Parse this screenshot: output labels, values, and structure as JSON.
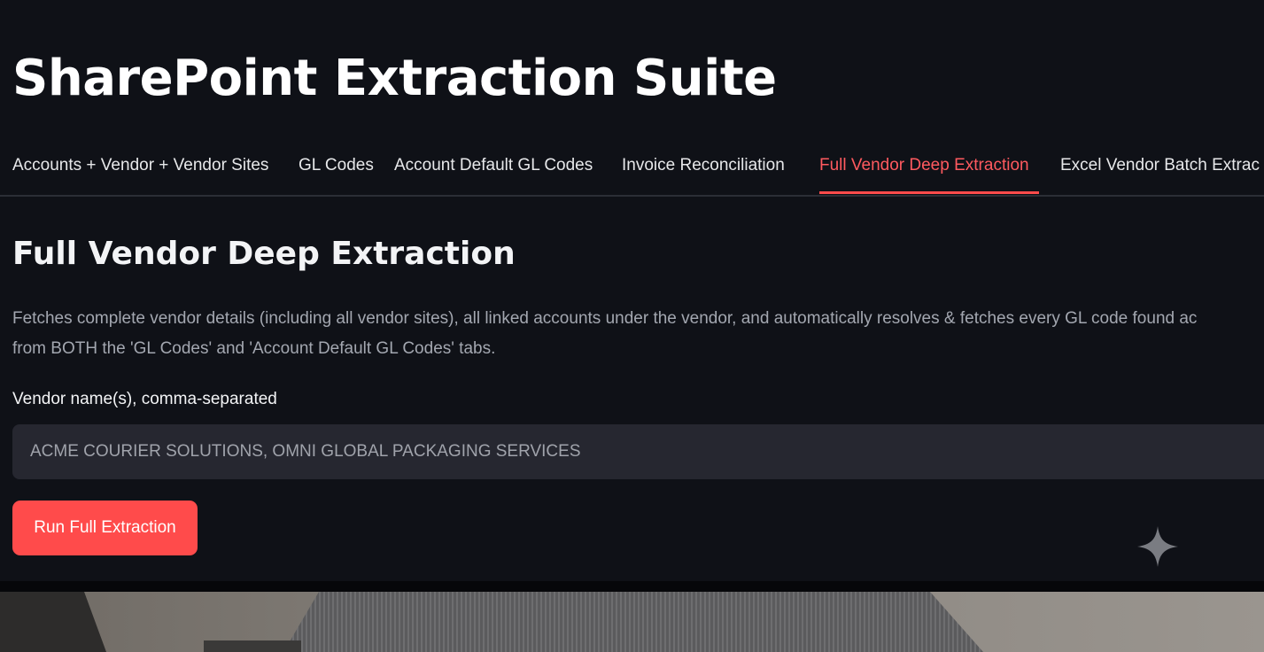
{
  "app": {
    "title": "SharePoint Extraction Suite"
  },
  "tabs": [
    {
      "label": "Accounts + Vendor + Vendor Sites",
      "active": false
    },
    {
      "label": "GL Codes",
      "active": false
    },
    {
      "label": "Account Default GL Codes",
      "active": false
    },
    {
      "label": "Invoice Reconciliation",
      "active": false
    },
    {
      "label": "Full Vendor Deep Extraction",
      "active": true
    },
    {
      "label": "Excel Vendor Batch Extrac",
      "active": false
    }
  ],
  "section": {
    "title": "Full Vendor Deep Extraction",
    "description_line1": "Fetches complete vendor details (including all vendor sites), all linked accounts under the vendor, and automatically resolves & fetches every GL code found ac",
    "description_line2": "from BOTH the 'GL Codes' and 'Account Default GL Codes' tabs."
  },
  "form": {
    "vendor_label": "Vendor name(s), comma-separated",
    "vendor_value": "ACME COURIER SOLUTIONS, OMNI GLOBAL PACKAGING SERVICES",
    "run_button_label": "Run Full Extraction"
  },
  "icons": {
    "sparkle": "sparkle-icon"
  },
  "colors": {
    "background": "#0f1117",
    "accent": "#ff4b4b",
    "active_tab_text": "#ff5a5f",
    "input_background": "#262730"
  }
}
